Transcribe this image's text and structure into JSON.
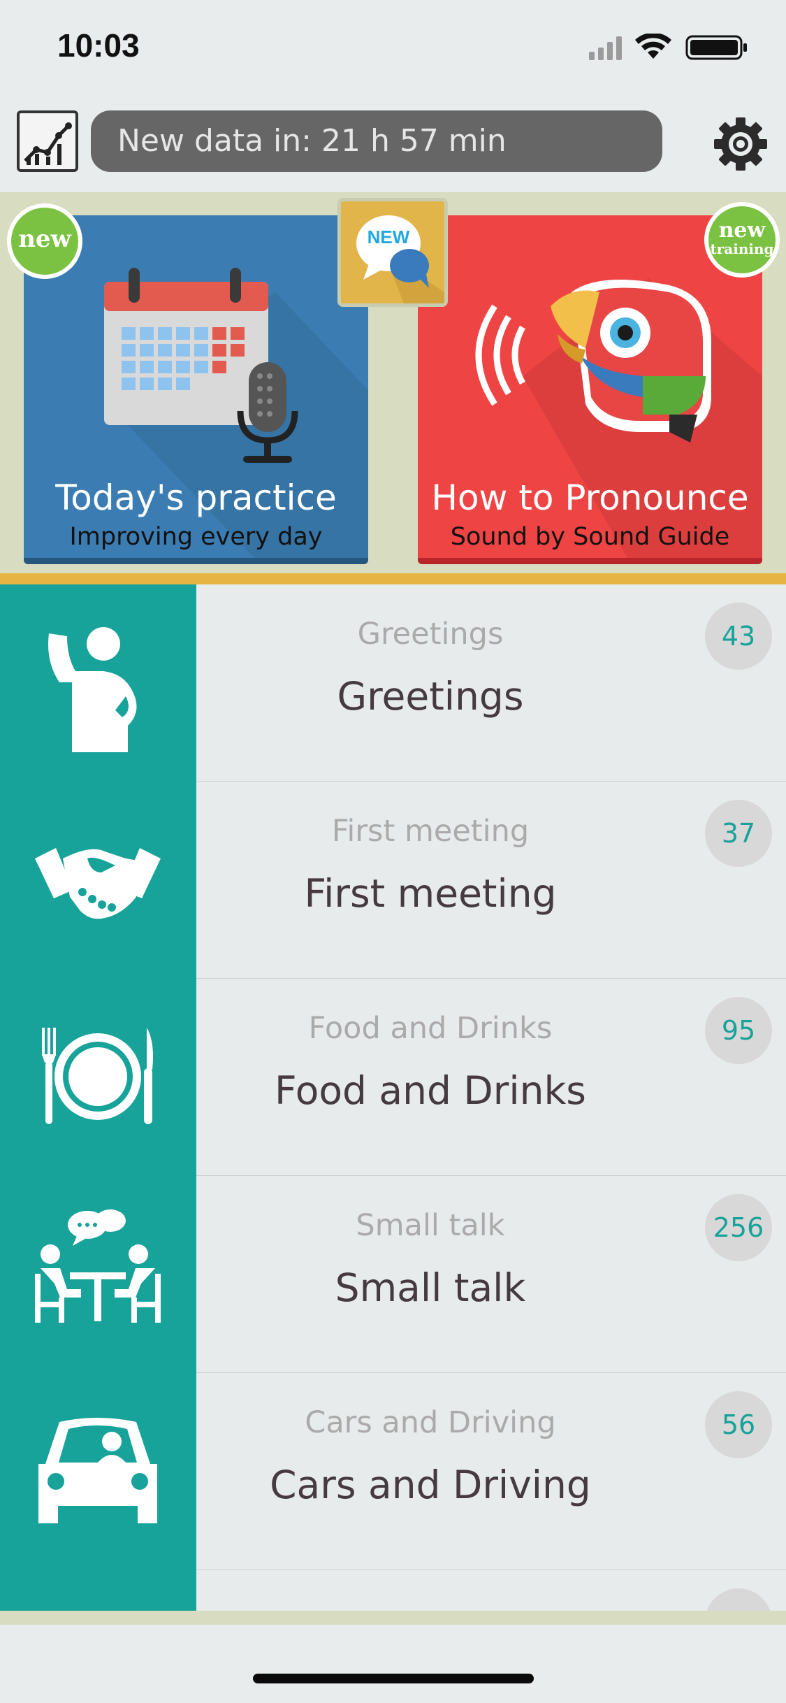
{
  "status_bar": {
    "time": "10:03"
  },
  "top_bar": {
    "countdown_text": "New data in: 21 h 57 min"
  },
  "featured": {
    "practice": {
      "badge": "new",
      "title": "Today's practice",
      "subtitle": "Improving every day"
    },
    "pronounce": {
      "badge_line1": "new",
      "badge_line2": "training",
      "title": "How to Pronounce",
      "subtitle": "Sound by Sound Guide"
    },
    "chat_badge": "NEW"
  },
  "topics": [
    {
      "subtitle": "Greetings",
      "title": "Greetings",
      "count": "43",
      "icon": "waving-person-icon"
    },
    {
      "subtitle": "First meeting",
      "title": "First meeting",
      "count": "37",
      "icon": "handshake-icon"
    },
    {
      "subtitle": "Food and Drinks",
      "title": "Food and Drinks",
      "count": "95",
      "icon": "plate-cutlery-icon"
    },
    {
      "subtitle": "Small talk",
      "title": "Small talk",
      "count": "256",
      "icon": "conversation-icon"
    },
    {
      "subtitle": "Cars and Driving",
      "title": "Cars and Driving",
      "count": "56",
      "icon": "car-icon"
    }
  ],
  "colors": {
    "teal": "#17a29a",
    "blue": "#3b7db3",
    "red": "#ef4444",
    "gold": "#e6b442",
    "green_badge": "#7cc242"
  }
}
